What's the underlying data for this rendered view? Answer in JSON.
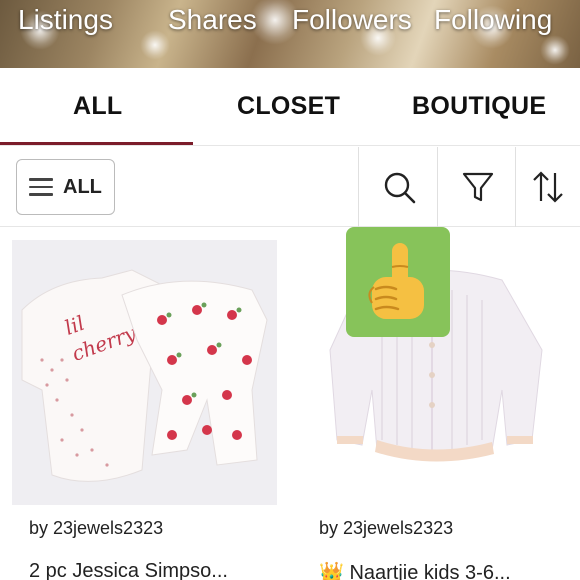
{
  "banner": {
    "stats": [
      "Listings",
      "Shares",
      "Followers",
      "Following"
    ]
  },
  "tabs": [
    {
      "label": "ALL",
      "active": true
    },
    {
      "label": "CLOSET",
      "active": false
    },
    {
      "label": "BOUTIQUE",
      "active": false
    }
  ],
  "filter": {
    "all_label": "ALL",
    "icons": [
      "menu-icon",
      "search-icon",
      "filter-icon",
      "sort-icon"
    ]
  },
  "listings": [
    {
      "byline": "by 23jewels2323",
      "title": "2 pc Jessica Simpso..."
    },
    {
      "byline": "by 23jewels2323",
      "title": "👑 Naartjie kids 3-6..."
    }
  ],
  "overlay": {
    "emoji": "☝️",
    "icon": "pointing-finger-icon"
  },
  "colors": {
    "tab_underline": "#7b1c2a",
    "overlay_bg": "#87c35a"
  }
}
